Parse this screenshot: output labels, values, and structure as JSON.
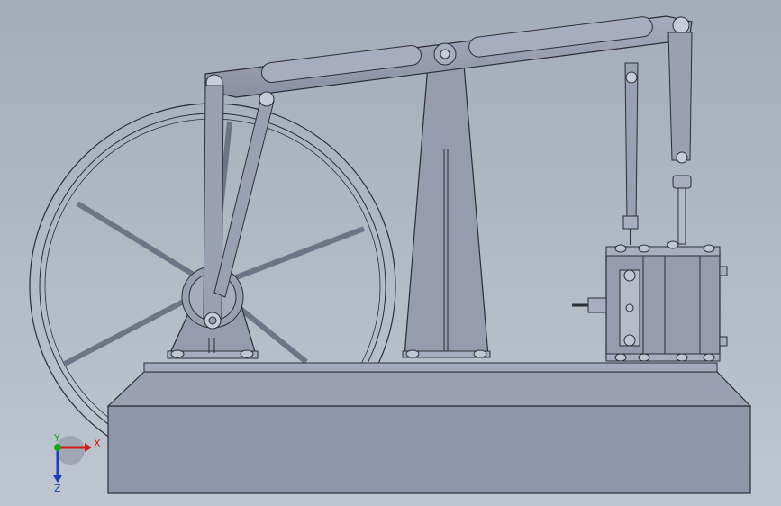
{
  "viewport": {
    "background_top": "#a3acb9",
    "background_bottom": "#bec6d0",
    "model_color": "#8f96a8",
    "model_color_light": "#9aa0b2",
    "edge_color": "#2a2d34"
  },
  "triad": {
    "x_label": "X",
    "y_label": "Y",
    "z_label": "Z",
    "x_color": "#d11c1c",
    "y_color": "#1aa51a",
    "z_color": "#1a3fb8"
  }
}
